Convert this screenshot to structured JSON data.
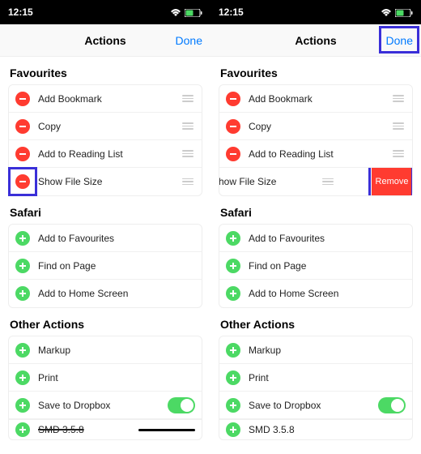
{
  "status": {
    "time": "12:15"
  },
  "nav": {
    "title": "Actions",
    "done": "Done"
  },
  "sections": {
    "favourites": {
      "header": "Favourites",
      "items": [
        "Add Bookmark",
        "Copy",
        "Add to Reading List",
        "Show File Size"
      ]
    },
    "safari": {
      "header": "Safari",
      "items": [
        "Add to Favourites",
        "Find on Page",
        "Add to Home Screen"
      ]
    },
    "other": {
      "header": "Other Actions",
      "items": [
        "Markup",
        "Print",
        "Save to Dropbox",
        "SMD 3.5.8"
      ]
    }
  },
  "swiped_label_partial": "ow File Size",
  "remove": "Remove"
}
